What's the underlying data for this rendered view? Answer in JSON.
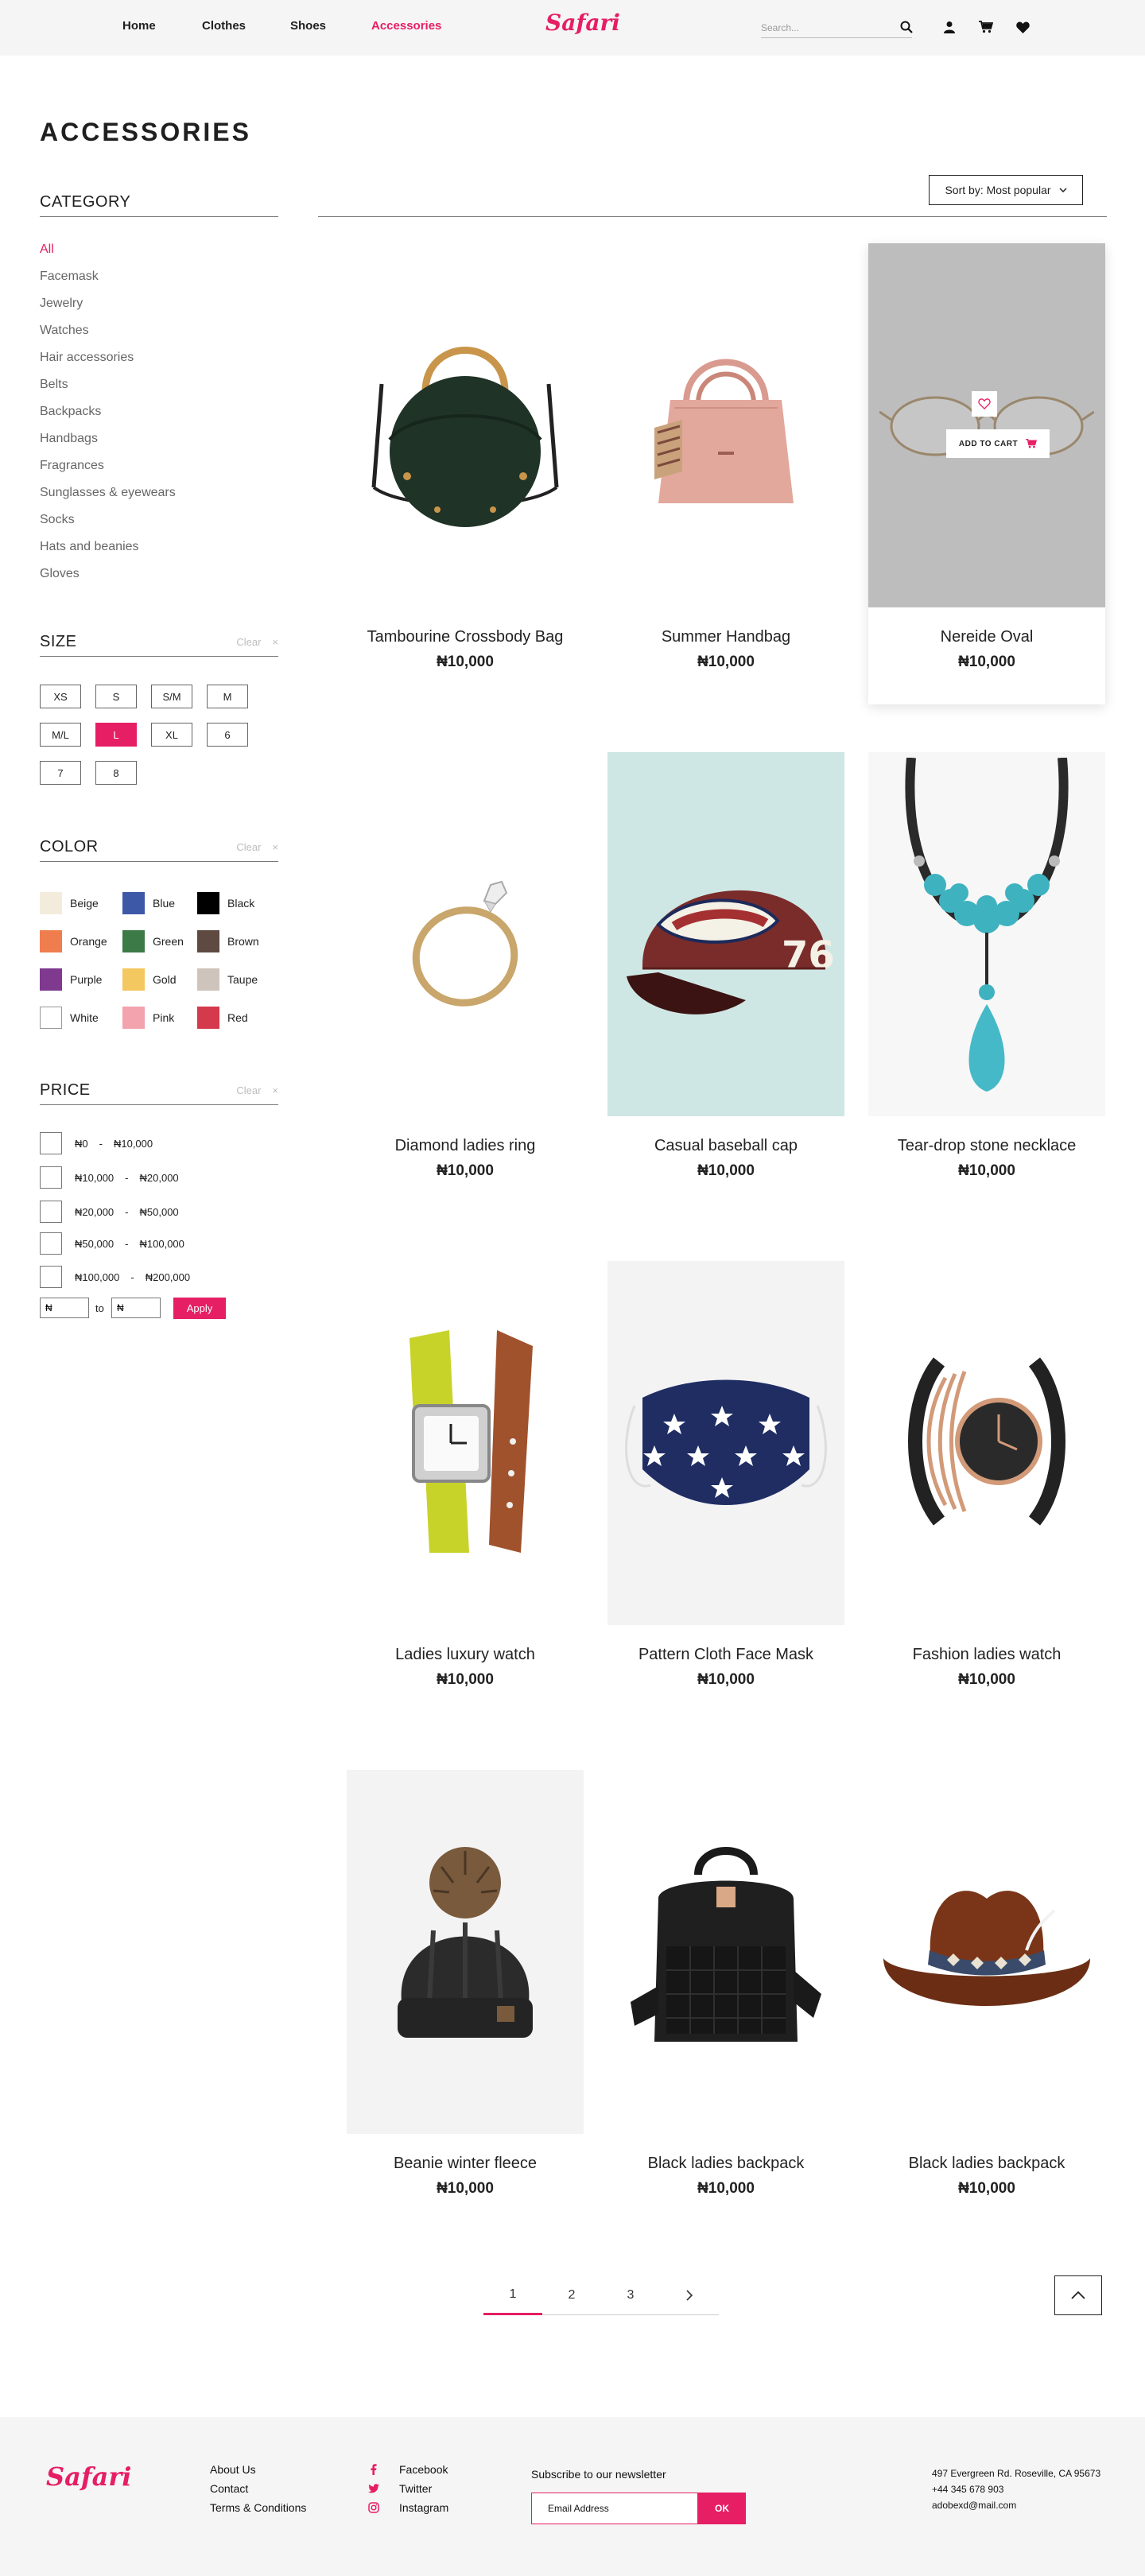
{
  "header": {
    "nav": [
      {
        "label": "Home"
      },
      {
        "label": "Clothes"
      },
      {
        "label": "Shoes"
      },
      {
        "label": "Accessories"
      }
    ],
    "logo": "Safari",
    "search_placeholder": "Search...",
    "accent_color": "#e61e64"
  },
  "page_title": "ACCESSORIES",
  "category": {
    "title": "CATEGORY",
    "items": [
      "All",
      "Facemask",
      "Jewelry",
      "Watches",
      "Hair accessories",
      "Belts",
      "Backpacks",
      "Handbags",
      "Fragrances",
      "Sunglasses & eyewears",
      "Socks",
      "Hats and beanies",
      "Gloves"
    ],
    "selected": "All"
  },
  "size": {
    "title": "SIZE",
    "clear": "Clear",
    "clear_x": "×",
    "options": [
      "XS",
      "S",
      "S/M",
      "M",
      "M/L",
      "L",
      "XL",
      "6",
      "7",
      "8"
    ],
    "selected": "L"
  },
  "color": {
    "title": "COLOR",
    "clear": "Clear",
    "clear_x": "×",
    "options": [
      {
        "label": "Beige",
        "hex": "#f3ecdc"
      },
      {
        "label": "Blue",
        "hex": "#3e58a8"
      },
      {
        "label": "Black",
        "hex": "#000000"
      },
      {
        "label": "Orange",
        "hex": "#ef7d4d"
      },
      {
        "label": "Green",
        "hex": "#3c7a47"
      },
      {
        "label": "Brown",
        "hex": "#5e4a41"
      },
      {
        "label": "Purple",
        "hex": "#7f3a8f"
      },
      {
        "label": "Gold",
        "hex": "#f4c860"
      },
      {
        "label": "Taupe",
        "hex": "#cfc4bb"
      },
      {
        "label": "White",
        "hex": "#ffffff"
      },
      {
        "label": "Pink",
        "hex": "#f2a3ae"
      },
      {
        "label": "Red",
        "hex": "#d5394c"
      }
    ]
  },
  "price": {
    "title": "PRICE",
    "clear": "Clear",
    "clear_x": "×",
    "ranges": [
      {
        "from": "₦0",
        "to": "₦10,000"
      },
      {
        "from": "₦10,000",
        "to": "₦20,000"
      },
      {
        "from": "₦20,000",
        "to": "₦50,000"
      },
      {
        "from": "₦50,000",
        "to": "₦100,000"
      },
      {
        "from": "₦100,000",
        "to": "₦200,000"
      }
    ],
    "custom_min": "₦",
    "to_label": "to",
    "custom_max": "₦",
    "apply": "Apply"
  },
  "sort": {
    "label": "Sort by: Most popular"
  },
  "product_hover": {
    "add_to_cart": "ADD TO CART"
  },
  "products": [
    {
      "name": "Tambourine Crossbody Bag",
      "price": "₦10,000",
      "bg": "#ffffff",
      "icon": "crossbody-bag"
    },
    {
      "name": "Summer Handbag",
      "price": "₦10,000",
      "bg": "#ffffff",
      "icon": "handbag"
    },
    {
      "name": "Nereide Oval",
      "price": "₦10,000",
      "bg": "#bdbdbd",
      "icon": "eyeglasses"
    },
    {
      "name": "Diamond ladies ring",
      "price": "₦10,000",
      "bg": "#ffffff",
      "icon": "ring"
    },
    {
      "name": "Casual baseball cap",
      "price": "₦10,000",
      "bg": "#cfe7e4",
      "icon": "baseball-cap"
    },
    {
      "name": "Tear-drop stone necklace",
      "price": "₦10,000",
      "bg": "#f7f7f7",
      "icon": "necklace"
    },
    {
      "name": "Ladies luxury watch",
      "price": "₦10,000",
      "bg": "#ffffff",
      "icon": "wrist-watch"
    },
    {
      "name": "Pattern Cloth Face Mask",
      "price": "₦10,000",
      "bg": "#f3f3f3",
      "icon": "face-mask"
    },
    {
      "name": "Fashion ladies watch",
      "price": "₦10,000",
      "bg": "#ffffff",
      "icon": "bracelet-watch"
    },
    {
      "name": "Beanie winter fleece",
      "price": "₦10,000",
      "bg": "#f3f3f3",
      "icon": "beanie"
    },
    {
      "name": "Black ladies backpack",
      "price": "₦10,000",
      "bg": "#ffffff",
      "icon": "backpack"
    },
    {
      "name": "Black ladies backpack",
      "price": "₦10,000",
      "bg": "#ffffff",
      "icon": "cowboy-hat"
    }
  ],
  "pagination": {
    "pages": [
      "1",
      "2",
      "3"
    ],
    "current": "1",
    "next_icon": "chevron-right-icon"
  },
  "footer": {
    "logo": "Safari",
    "links": [
      "About Us",
      "Contact",
      "Terms & Conditions"
    ],
    "social": [
      {
        "label": "Facebook",
        "icon": "facebook-icon"
      },
      {
        "label": "Twitter",
        "icon": "twitter-icon"
      },
      {
        "label": "Instagram",
        "icon": "instagram-icon"
      }
    ],
    "newsletter_label": "Subscribe to our newsletter",
    "email_placeholder": "Email Address",
    "ok": "OK",
    "address": [
      "497 Evergreen Rd. Roseville, CA 95673",
      "+44 345 678 903",
      "adobexd@mail.com"
    ]
  }
}
